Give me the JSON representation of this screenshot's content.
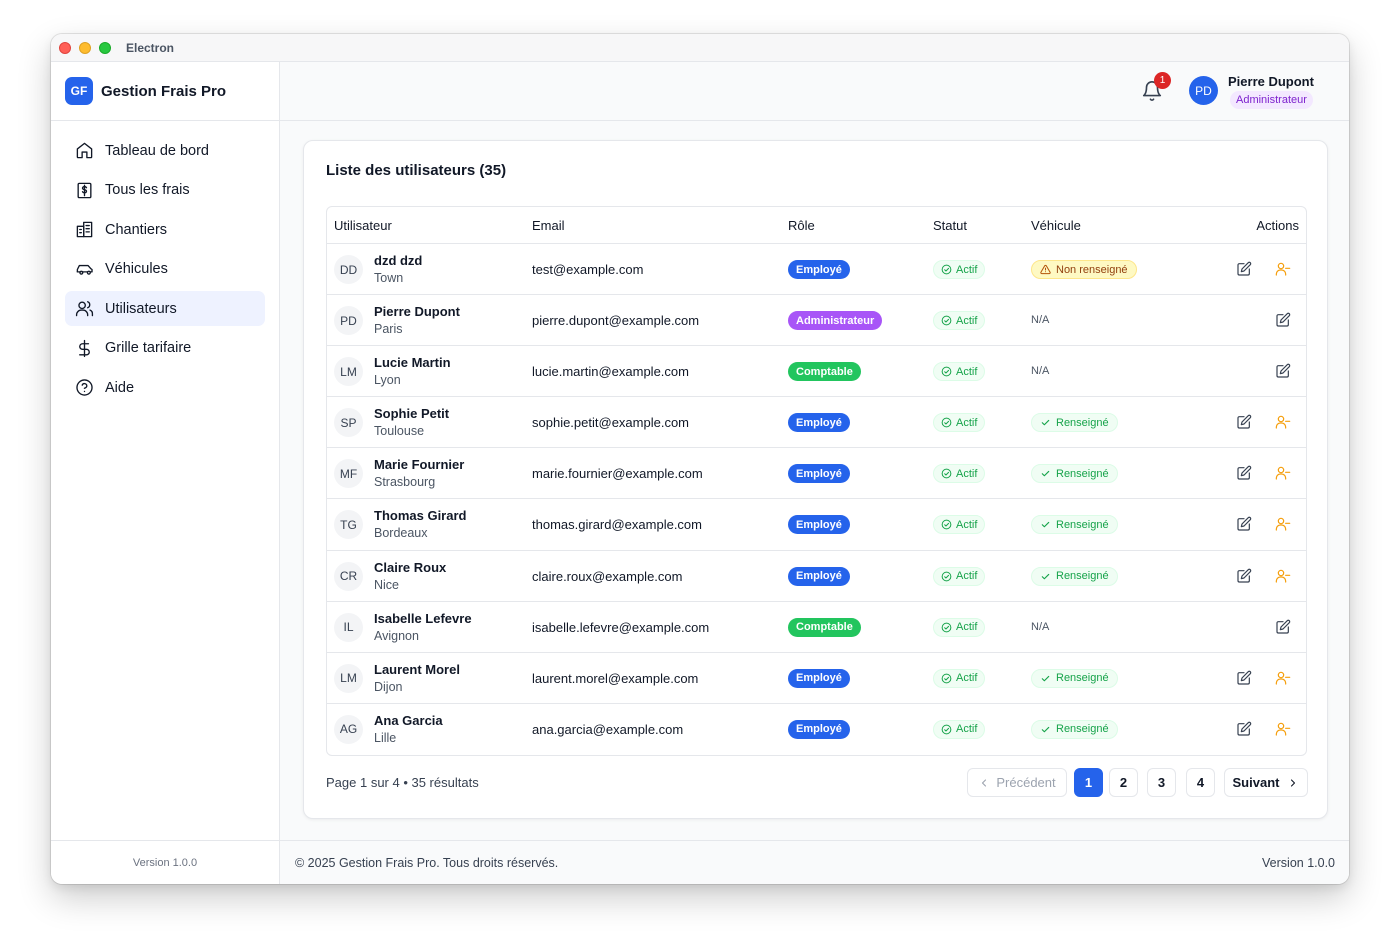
{
  "window": {
    "title": "Electron"
  },
  "brand": {
    "logo": "GF",
    "name": "Gestion Frais Pro"
  },
  "sidebar": {
    "items": [
      {
        "label": "Tableau de bord",
        "icon": "home-icon"
      },
      {
        "label": "Tous les frais",
        "icon": "receipt-icon"
      },
      {
        "label": "Chantiers",
        "icon": "building-icon"
      },
      {
        "label": "Véhicules",
        "icon": "car-icon"
      },
      {
        "label": "Utilisateurs",
        "icon": "users-icon",
        "active": true
      },
      {
        "label": "Grille tarifaire",
        "icon": "dollar-icon"
      },
      {
        "label": "Aide",
        "icon": "help-icon"
      }
    ],
    "version": "Version 1.0.0"
  },
  "header": {
    "notifications": "1",
    "user": {
      "initials": "PD",
      "name": "Pierre Dupont",
      "role": "Administrateur"
    }
  },
  "users_card": {
    "title": "Liste des utilisateurs (35)",
    "columns": {
      "user": "Utilisateur",
      "email": "Email",
      "role": "Rôle",
      "status": "Statut",
      "vehicle": "Véhicule",
      "actions": "Actions"
    },
    "rows": [
      {
        "initials": "DD",
        "name": "dzd dzd",
        "city": "Town",
        "email": "test@example.com",
        "role": "Employé",
        "role_type": "emp",
        "status": "Actif",
        "vehicle": "Non renseigné",
        "vehicle_type": "missing"
      },
      {
        "initials": "PD",
        "name": "Pierre Dupont",
        "city": "Paris",
        "email": "pierre.dupont@example.com",
        "role": "Administrateur",
        "role_type": "adm",
        "status": "Actif",
        "vehicle": "N/A",
        "vehicle_type": "na"
      },
      {
        "initials": "LM",
        "name": "Lucie Martin",
        "city": "Lyon",
        "email": "lucie.martin@example.com",
        "role": "Comptable",
        "role_type": "cpt",
        "status": "Actif",
        "vehicle": "N/A",
        "vehicle_type": "na"
      },
      {
        "initials": "SP",
        "name": "Sophie Petit",
        "city": "Toulouse",
        "email": "sophie.petit@example.com",
        "role": "Employé",
        "role_type": "emp",
        "status": "Actif",
        "vehicle": "Renseigné",
        "vehicle_type": "ok"
      },
      {
        "initials": "MF",
        "name": "Marie Fournier",
        "city": "Strasbourg",
        "email": "marie.fournier@example.com",
        "role": "Employé",
        "role_type": "emp",
        "status": "Actif",
        "vehicle": "Renseigné",
        "vehicle_type": "ok"
      },
      {
        "initials": "TG",
        "name": "Thomas Girard",
        "city": "Bordeaux",
        "email": "thomas.girard@example.com",
        "role": "Employé",
        "role_type": "emp",
        "status": "Actif",
        "vehicle": "Renseigné",
        "vehicle_type": "ok"
      },
      {
        "initials": "CR",
        "name": "Claire Roux",
        "city": "Nice",
        "email": "claire.roux@example.com",
        "role": "Employé",
        "role_type": "emp",
        "status": "Actif",
        "vehicle": "Renseigné",
        "vehicle_type": "ok"
      },
      {
        "initials": "IL",
        "name": "Isabelle Lefevre",
        "city": "Avignon",
        "email": "isabelle.lefevre@example.com",
        "role": "Comptable",
        "role_type": "cpt",
        "status": "Actif",
        "vehicle": "N/A",
        "vehicle_type": "na"
      },
      {
        "initials": "LM",
        "name": "Laurent Morel",
        "city": "Dijon",
        "email": "laurent.morel@example.com",
        "role": "Employé",
        "role_type": "emp",
        "status": "Actif",
        "vehicle": "Renseigné",
        "vehicle_type": "ok"
      },
      {
        "initials": "AG",
        "name": "Ana Garcia",
        "city": "Lille",
        "email": "ana.garcia@example.com",
        "role": "Employé",
        "role_type": "emp",
        "status": "Actif",
        "vehicle": "Renseigné",
        "vehicle_type": "ok"
      }
    ],
    "pagination": {
      "info": "Page 1 sur 4 • 35 résultats",
      "prev": "Précédent",
      "pages": [
        "1",
        "2",
        "3",
        "4"
      ],
      "current": "1",
      "next": "Suivant"
    }
  },
  "footer": {
    "copyright": "© 2025 Gestion Frais Pro. Tous droits réservés.",
    "version": "Version 1.0.0"
  },
  "colors": {
    "accent": "#2563eb",
    "admin": "#a855f7",
    "accountant": "#22c55e",
    "active_green": "#16a34a",
    "warning": "#92400e",
    "assign_icon": "#f59e0b"
  }
}
